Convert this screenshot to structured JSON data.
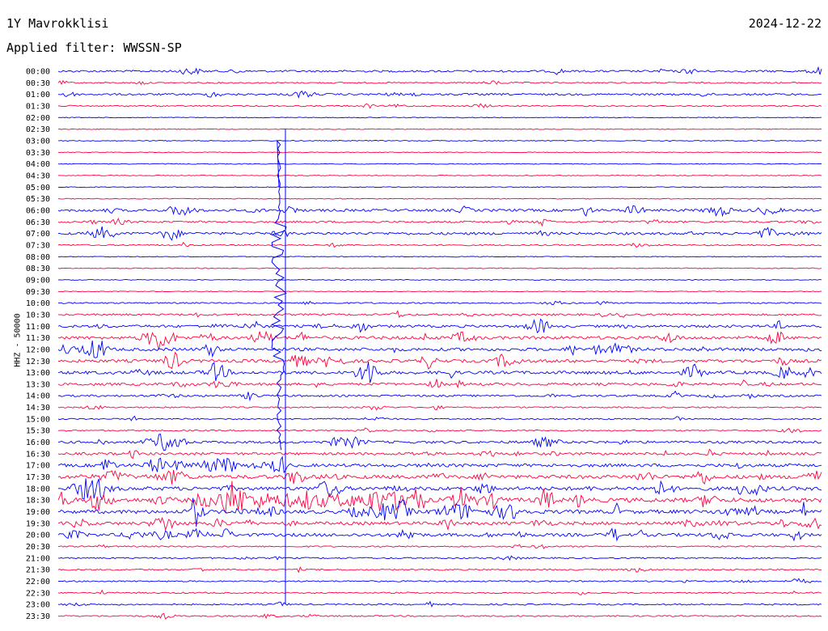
{
  "header": {
    "station": "1Y Mavrokklisi",
    "date": "2024-12-22",
    "filter": "Applied filter: WWSSN-SP"
  },
  "channel": "HHZ - 50000",
  "chart_data": {
    "type": "line",
    "title": "",
    "time_labels": [
      "00:00",
      "00:30",
      "01:00",
      "01:30",
      "02:00",
      "02:30",
      "03:00",
      "03:30",
      "04:00",
      "04:30",
      "05:00",
      "05:30",
      "06:00",
      "06:30",
      "07:00",
      "07:30",
      "08:00",
      "08:30",
      "09:00",
      "09:30",
      "10:00",
      "10:30",
      "11:00",
      "11:30",
      "12:00",
      "12:30",
      "13:00",
      "13:30",
      "14:00",
      "14:30",
      "15:00",
      "15:30",
      "16:00",
      "16:30",
      "17:00",
      "17:30",
      "18:00",
      "18:30",
      "19:00",
      "19:30",
      "20:00",
      "20:30",
      "21:00",
      "21:30",
      "22:00",
      "22:30",
      "23:00",
      "23:30"
    ],
    "colors": {
      "even": "#0000ff",
      "odd": "#ff0040"
    },
    "activity": [
      2,
      1,
      2,
      1,
      0,
      0,
      0,
      0,
      0,
      0,
      0,
      0,
      3,
      2,
      3,
      1,
      0,
      0,
      0,
      0,
      1,
      2,
      3,
      4,
      4,
      4,
      4,
      3,
      2,
      1,
      1,
      1,
      3,
      3,
      4,
      5,
      5,
      6,
      5,
      4,
      4,
      1,
      1,
      1,
      1,
      1,
      1,
      1
    ],
    "major_event_time": "11:30"
  }
}
